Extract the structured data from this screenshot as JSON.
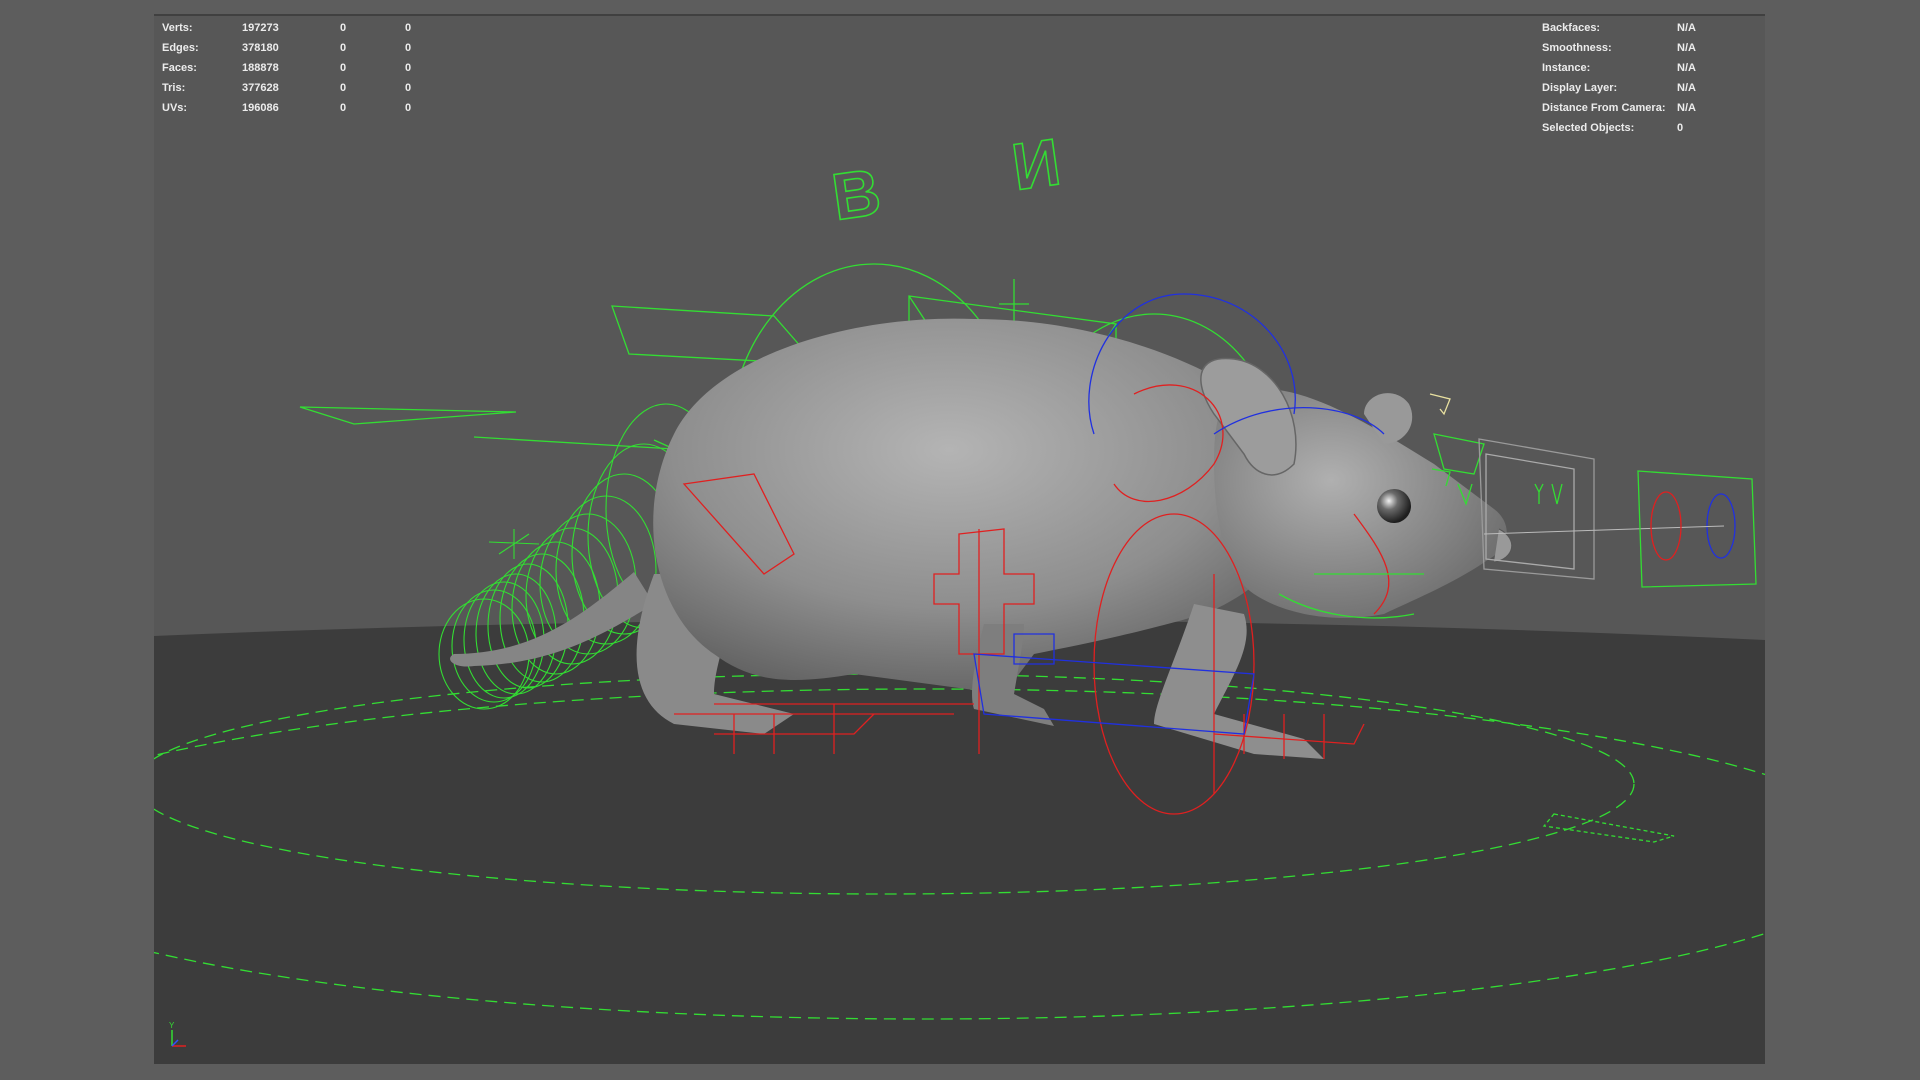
{
  "heads_up_display": {
    "poly_count": [
      {
        "label": "Verts:",
        "values": [
          "197273",
          "0",
          "0"
        ]
      },
      {
        "label": "Edges:",
        "values": [
          "378180",
          "0",
          "0"
        ]
      },
      {
        "label": "Faces:",
        "values": [
          "188878",
          "0",
          "0"
        ]
      },
      {
        "label": "Tris:",
        "values": [
          "377628",
          "0",
          "0"
        ]
      },
      {
        "label": "UVs:",
        "values": [
          "196086",
          "0",
          "0"
        ]
      }
    ],
    "object_details": [
      {
        "label": "Backfaces:",
        "value": "N/A"
      },
      {
        "label": "Smoothness:",
        "value": "N/A"
      },
      {
        "label": "Instance:",
        "value": "N/A"
      },
      {
        "label": "Display Layer:",
        "value": "N/A"
      },
      {
        "label": "Distance From Camera:",
        "value": "N/A"
      },
      {
        "label": "Selected Objects:",
        "value": "0"
      }
    ]
  },
  "rig_control_letters": {
    "left": "B",
    "right": "И"
  },
  "axis_indicator": {
    "label": "Y"
  },
  "colors": {
    "viewport_background": "#575757",
    "ground": "#3c3c3c",
    "hud_text": "#ececec",
    "control_green": "#33dd33",
    "control_red": "#e02020",
    "control_blue": "#2030e0",
    "mesh": "#9a9a9a"
  }
}
